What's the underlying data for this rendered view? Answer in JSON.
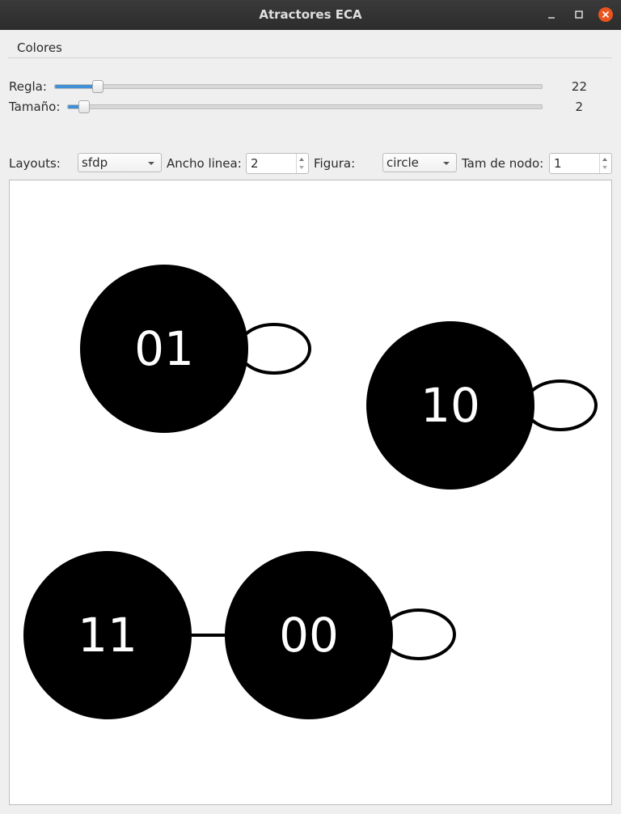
{
  "window": {
    "title": "Atractores ECA"
  },
  "menu": {
    "colores": "Colores"
  },
  "controls": {
    "regla": {
      "label": "Regla:",
      "value": "22",
      "fraction": 0.0873
    },
    "tamano": {
      "label": "Tamaño:",
      "value": "2",
      "fraction": 0.0339
    },
    "layouts": {
      "label": "Layouts:",
      "selected": "sfdp"
    },
    "ancho_linea": {
      "label": "Ancho linea:",
      "value": "2"
    },
    "figura": {
      "label": "Figura:",
      "selected": "circle"
    },
    "tam_nodo": {
      "label": "Tam de nodo:",
      "value": "1"
    }
  },
  "graph": {
    "nodes": [
      {
        "label": "01"
      },
      {
        "label": "10"
      },
      {
        "label": "11"
      },
      {
        "label": "00"
      }
    ]
  },
  "colors": {
    "titlebar": "#2c2c2c",
    "close": "#e9541f",
    "accent": "#3f8fd6",
    "node": "#000000"
  },
  "icons": {
    "minimize": "minimize-icon",
    "maximize": "maximize-icon",
    "close": "close-icon"
  }
}
